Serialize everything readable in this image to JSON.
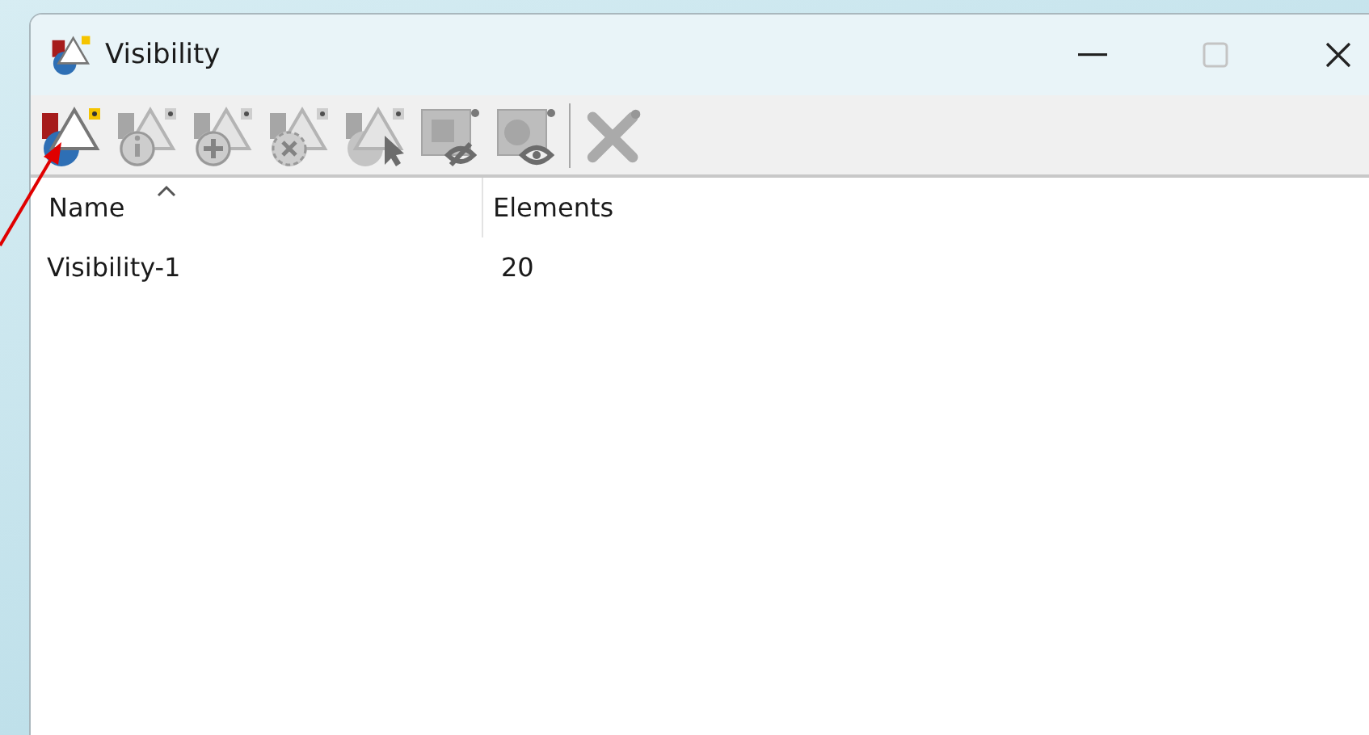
{
  "window": {
    "title": "Visibility",
    "maximize_disabled": true
  },
  "toolbar": [
    {
      "kind": "new",
      "disabled": false
    },
    {
      "kind": "info",
      "disabled": true
    },
    {
      "kind": "add",
      "disabled": true
    },
    {
      "kind": "remove",
      "disabled": true
    },
    {
      "kind": "select",
      "disabled": true
    },
    {
      "kind": "hide",
      "disabled": true
    },
    {
      "kind": "show",
      "disabled": true
    },
    {
      "kind": "separator"
    },
    {
      "kind": "delete",
      "disabled": true
    }
  ],
  "table": {
    "columns": [
      {
        "label": "Name",
        "sorted": true
      },
      {
        "label": "Elements",
        "sorted": false
      }
    ],
    "rows": [
      [
        "Visibility-1",
        "20"
      ]
    ]
  },
  "annotation": {
    "kind": "arrow"
  }
}
